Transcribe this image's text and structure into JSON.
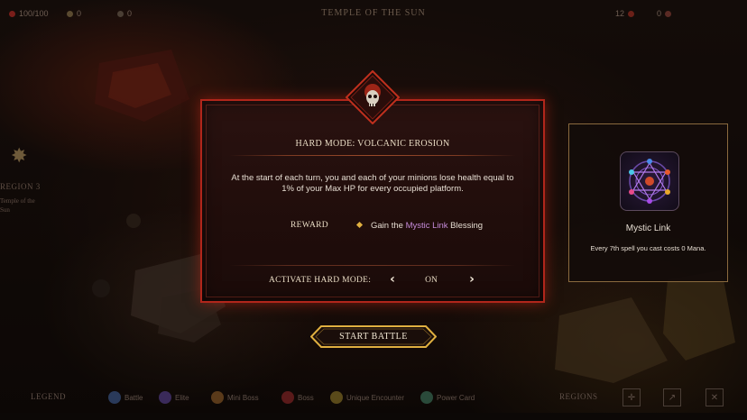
{
  "top_bar": {
    "title": "TEMPLE OF THE SUN",
    "hp": "100/100",
    "stat_a": "0",
    "stat_b": "0",
    "stat_c": "12",
    "stat_d": "0"
  },
  "side_region": {
    "name": "REGION 3",
    "subtitle": "Temple of the Sun"
  },
  "modal": {
    "title": "HARD MODE: VOLCANIC EROSION",
    "description": "At the start of each turn, you and each of your minions lose health equal to 1% of your Max HP for every occupied platform.",
    "reward_label": "REWARD",
    "reward_prefix": "Gain the ",
    "reward_highlight": "Mystic Link",
    "reward_suffix": " Blessing",
    "activate_label": "ACTIVATE HARD MODE:",
    "toggle_value": "ON",
    "emblem_icon": "skull-icon"
  },
  "blessing_card": {
    "name": "Mystic Link",
    "description": "Every 7th spell you cast costs 0 Mana.",
    "icon": "mystic-link-icon"
  },
  "start_button": {
    "label": "START BATTLE"
  },
  "legend": {
    "title": "LEGEND",
    "items": [
      "Battle",
      "Elite",
      "Mini Boss",
      "Boss",
      "Unique Encounter",
      "Power Card"
    ],
    "region_label": "REGIONS"
  },
  "colors": {
    "accent_red": "#b1261b",
    "gold": "#e0b040",
    "highlight_purple": "#c58bd9",
    "card_border": "#8a6a3e"
  }
}
